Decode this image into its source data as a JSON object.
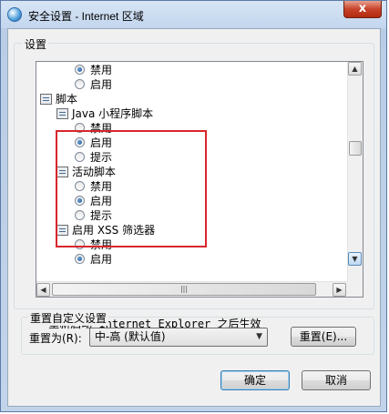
{
  "window": {
    "title": "安全设置 - Internet 区域",
    "close_label": "x"
  },
  "settings": {
    "group_label": "设置",
    "items": [
      {
        "type": "radio",
        "label": "禁用",
        "checked": true
      },
      {
        "type": "radio",
        "label": "启用",
        "checked": false
      },
      {
        "type": "category",
        "label": "脚本"
      },
      {
        "type": "subcategory",
        "label": "Java 小程序脚本"
      },
      {
        "type": "radio",
        "label": "禁用",
        "checked": false
      },
      {
        "type": "radio",
        "label": "启用",
        "checked": true
      },
      {
        "type": "radio",
        "label": "提示",
        "checked": false
      },
      {
        "type": "subcategory",
        "label": "活动脚本"
      },
      {
        "type": "radio",
        "label": "禁用",
        "checked": false
      },
      {
        "type": "radio",
        "label": "启用",
        "checked": true
      },
      {
        "type": "radio",
        "label": "提示",
        "checked": false
      },
      {
        "type": "subcategory",
        "label": "启用 XSS 筛选器"
      },
      {
        "type": "radio",
        "label": "禁用",
        "checked": false
      },
      {
        "type": "radio",
        "label": "启用",
        "checked": true
      }
    ],
    "restart_note": "*重新启动 Internet Explorer 之后生效"
  },
  "reset": {
    "group_label": "重置自定义设置",
    "reset_to_label": "重置为(R):",
    "selected_level": "中-高 (默认值)",
    "reset_button": "重置(E)..."
  },
  "footer": {
    "ok_label": "确定",
    "cancel_label": "取消"
  },
  "scrollbar": {
    "up_arrow": "▲",
    "down_arrow": "▼",
    "left_arrow": "◀",
    "right_arrow": "▶",
    "grip": "|||",
    "dropdown_arrow": "▼"
  },
  "colors": {
    "highlight_box": "#d8262c",
    "accent": "#3c7fb1"
  }
}
